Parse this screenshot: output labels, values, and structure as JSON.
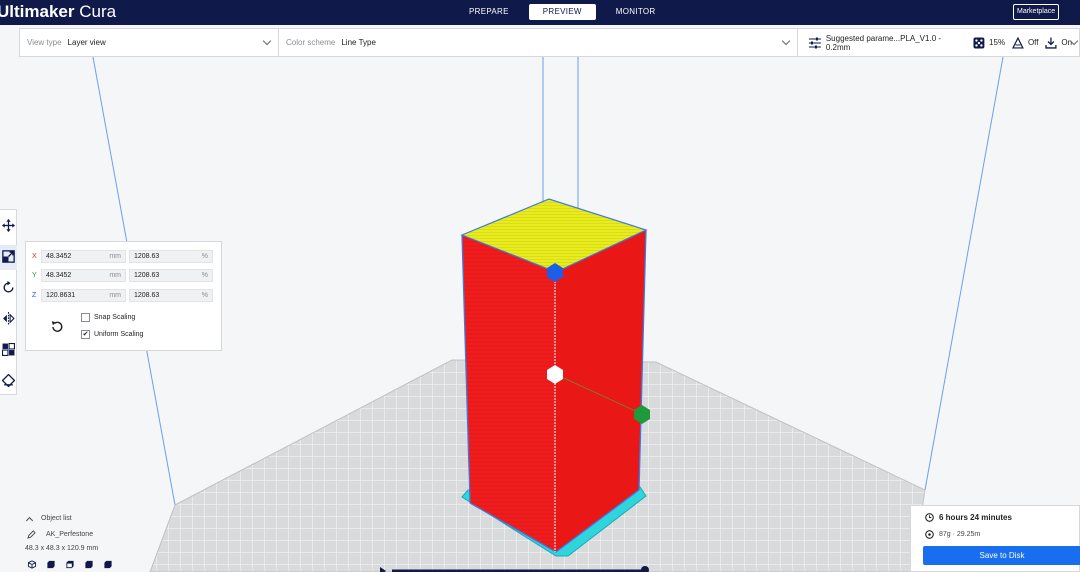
{
  "app": {
    "title_bold": "Ultimaker",
    "title_light": " Cura"
  },
  "stages": [
    {
      "label": "PREPARE",
      "active": false
    },
    {
      "label": "PREVIEW",
      "active": true
    },
    {
      "label": "MONITOR",
      "active": false
    }
  ],
  "marketplace_label": "Marketplace",
  "toolbar": {
    "view_type_label": "View type",
    "view_type_value": "Layer view",
    "color_scheme_label": "Color scheme",
    "color_scheme_value": "Line Type",
    "profile": "Suggested parame...PLA_V1.0 - 0.2mm",
    "infill": "15%",
    "support": "Off",
    "adhesion": "On"
  },
  "scale_panel": {
    "x_axis": "X",
    "x_mm": "48.3452",
    "x_pct": "1208.63",
    "y_axis": "Y",
    "y_mm": "48.3452",
    "y_pct": "1208.63",
    "z_axis": "Z",
    "z_mm": "120.8631",
    "z_pct": "1208.63",
    "mm_unit": "mm",
    "pct_unit": "%",
    "snap_label": "Snap Scaling",
    "snap_checked": false,
    "uniform_label": "Uniform Scaling",
    "uniform_checked": true
  },
  "object_list": {
    "header": "Object list",
    "object_name": "AK_Perfestone",
    "dimensions": "48.3 x 48.3 x 120.9 mm"
  },
  "print_info": {
    "time": "6 hours 24 minutes",
    "material": "87g · 29.25m",
    "save_button": "Save to Disk"
  },
  "colors": {
    "header_bg": "#0f1a4a",
    "accent": "#196ef0",
    "model_wall": "#ee1c1c",
    "model_top": "#e8ea1a",
    "skirt": "#2ad6de",
    "axis_x": "#d62828",
    "axis_y": "#1f9a3a",
    "axis_z": "#1d5ee8"
  }
}
